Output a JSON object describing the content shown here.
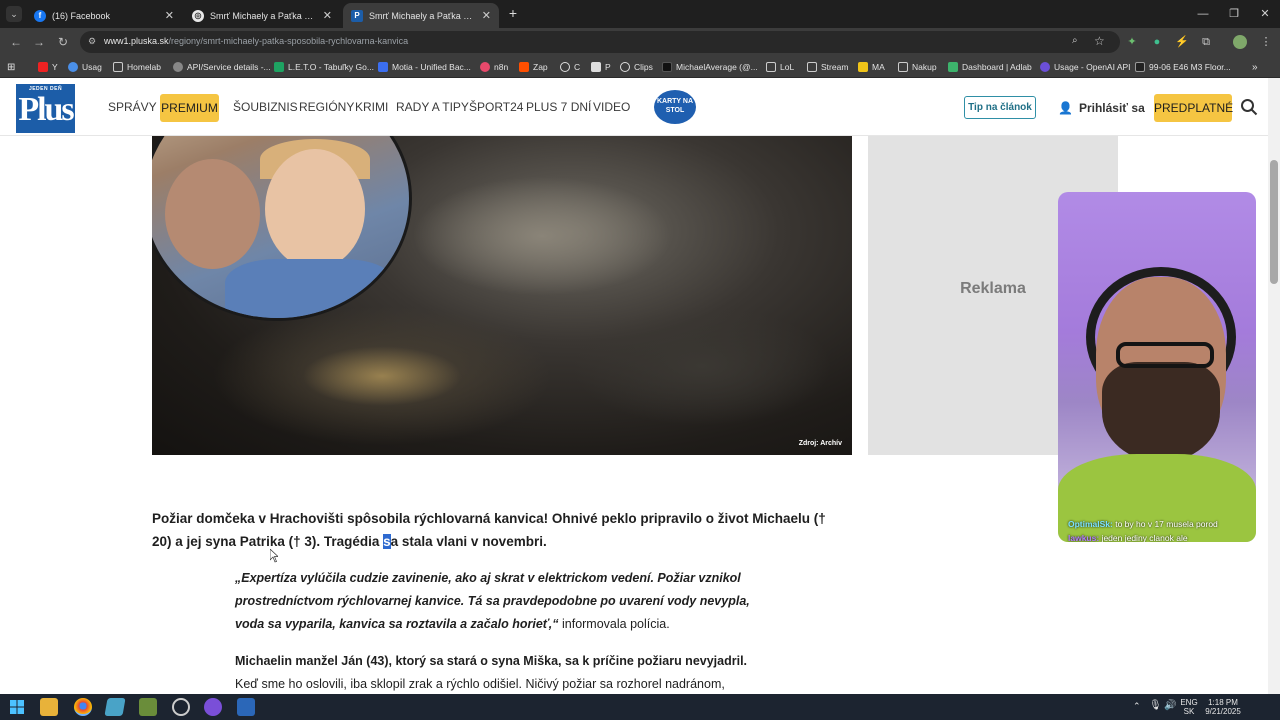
{
  "browser": {
    "tabs": [
      {
        "title": "(16) Facebook",
        "icon": "facebook-icon",
        "active": false
      },
      {
        "title": "Smrť Michaely a Paťka spôsobil",
        "icon": "chrome-icon",
        "active": false
      },
      {
        "title": "Smrť Michaely a Paťka spôsobil",
        "icon": "plus-favicon",
        "active": true
      }
    ],
    "new_tab": "+",
    "url_host": "www1.pluska.sk",
    "url_path": "/regiony/smrt-michaely-patka-sposobila-rychlovarna-kanvica",
    "bookmarks": [
      "Y",
      "Usag",
      "Homelab",
      "API/Service details -...",
      "L.E.T.O - Tabuľky Go...",
      "Motia - Unified Bac...",
      "n8n",
      "Zap",
      "C",
      "P",
      "Clips",
      "MichaelAverage (@...",
      "LoL",
      "Stream",
      "MA",
      "Nakup",
      "Dashboard | Adlab",
      "Usage - OpenAI API",
      "99-06 E46 M3 Floor..."
    ],
    "bookmarks_more": "»"
  },
  "site": {
    "logo_top": "JEDEN DEŇ",
    "logo_word": "Plus",
    "nav": [
      "SPRÁVY",
      "ŠOUBIZNIS",
      "REGIÓNY",
      "KRIMI",
      "RADY A TIPY",
      "ŠPORT24",
      "PLUS 7 DNÍ",
      "VIDEO"
    ],
    "premium": "PREMIUM",
    "karty": "KARTY NA STOL",
    "tip": "Tip na článok",
    "login": "Prihlásiť sa",
    "subscribe": "PREDPLATNÉ"
  },
  "article": {
    "photo_caption": "Zdroj: Archív",
    "ad_label": "Reklama",
    "lead_part1": "Požiar domčeka v Hrachovišti spôsobila rýchlovarná kanvica! Ohnivé peklo pripravilo o život Michaelu († 20) a jej syna Patrika († 3). Tragédia ",
    "lead_selected": "s",
    "lead_part2": "a stala vlani v novembri.",
    "quote_italic": "„Expertíza vylúčila cudzie zavinenie, ako aj skrat v elektrickom vedení. Požiar vznikol prostredníctvom rýchlovarnej kanvice. Tá sa pravdepodobne po uvarení vody nevypla, voda sa vyparila, kanvica sa roztavila a začalo horieť,“",
    "quote_normal": " informovala polícia.",
    "para2_bold": "Michaelin manžel Ján (43), ktorý sa stará o syna Miška, sa k príčine požiaru nevyjadril.",
    "para2_normal": "Keď sme ho oslovili, iba sklopil zrak a rýchlo odišiel. Ničivý požiar sa rozhorel nadránom,"
  },
  "webcam": {
    "chat1_name": "OptimalSk:",
    "chat1_text": " to by ho v 17 musela porod",
    "chat2_name": "lawkus:",
    "chat2_text": " jeden jediny clanok ale"
  },
  "taskbar": {
    "lang1": "ENG",
    "lang2": "SK",
    "time": "1:18 PM",
    "date": "9/21/2025"
  },
  "colors": {
    "accent_yellow": "#f5c542",
    "brand_blue": "#1c5da8",
    "selection": "#2e6ad0"
  }
}
